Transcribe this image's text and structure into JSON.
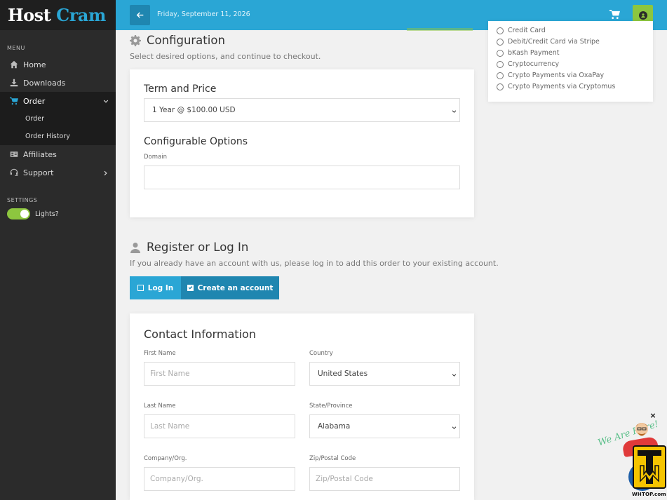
{
  "brand": {
    "part1": "Host",
    "part2": "Cram"
  },
  "sidebar": {
    "menu_label": "MENU",
    "items": [
      {
        "label": "Home",
        "icon": "home-icon"
      },
      {
        "label": "Downloads",
        "icon": "download-icon"
      },
      {
        "label": "Order",
        "icon": "cart-icon",
        "active": true
      },
      {
        "label": "Affiliates",
        "icon": "affiliates-icon"
      },
      {
        "label": "Support",
        "icon": "support-icon"
      }
    ],
    "order_sub": [
      "Order",
      "Order History"
    ],
    "settings_label": "SETTINGS",
    "lights_label": "Lights?",
    "lights_on": true
  },
  "topbar": {
    "date": "Friday, September 11, 2026"
  },
  "configuration": {
    "title": "Configuration",
    "subtitle": "Select desired options, and continue to checkout.",
    "term_heading": "Term and Price",
    "term_value": "1 Year @ $100.00 USD",
    "options_heading": "Configurable Options",
    "domain_label": "Domain",
    "domain_value": ""
  },
  "register": {
    "title": "Register or Log In",
    "subtitle": "If you already have an account with us, please log in to add this order to your existing account.",
    "login_label": "Log In",
    "create_label": "Create an account"
  },
  "contact": {
    "heading": "Contact Information",
    "first_name_label": "First Name",
    "first_name_placeholder": "First Name",
    "country_label": "Country",
    "country_value": "United States",
    "last_name_label": "Last Name",
    "last_name_placeholder": "Last Name",
    "state_label": "State/Province",
    "state_value": "Alabama",
    "company_label": "Company/Org.",
    "company_placeholder": "Company/Org.",
    "zip_label": "Zip/Postal Code",
    "zip_placeholder": "Zip/Postal Code"
  },
  "payment": {
    "options": [
      "Credit Card",
      "Debit/Credit Card via Stripe",
      "bKash Payment",
      "Cryptocurrency",
      "Crypto Payments via OxaPay",
      "Crypto Payments via Cryptomus"
    ]
  },
  "chat": {
    "text": "We Are Here!",
    "badge": "WHTOP.com",
    "close": "×"
  },
  "colors": {
    "accent": "#2aa6d5",
    "accent_dark": "#1f86b0",
    "green": "#8dc63f",
    "sidebar": "#2b2b2b"
  }
}
